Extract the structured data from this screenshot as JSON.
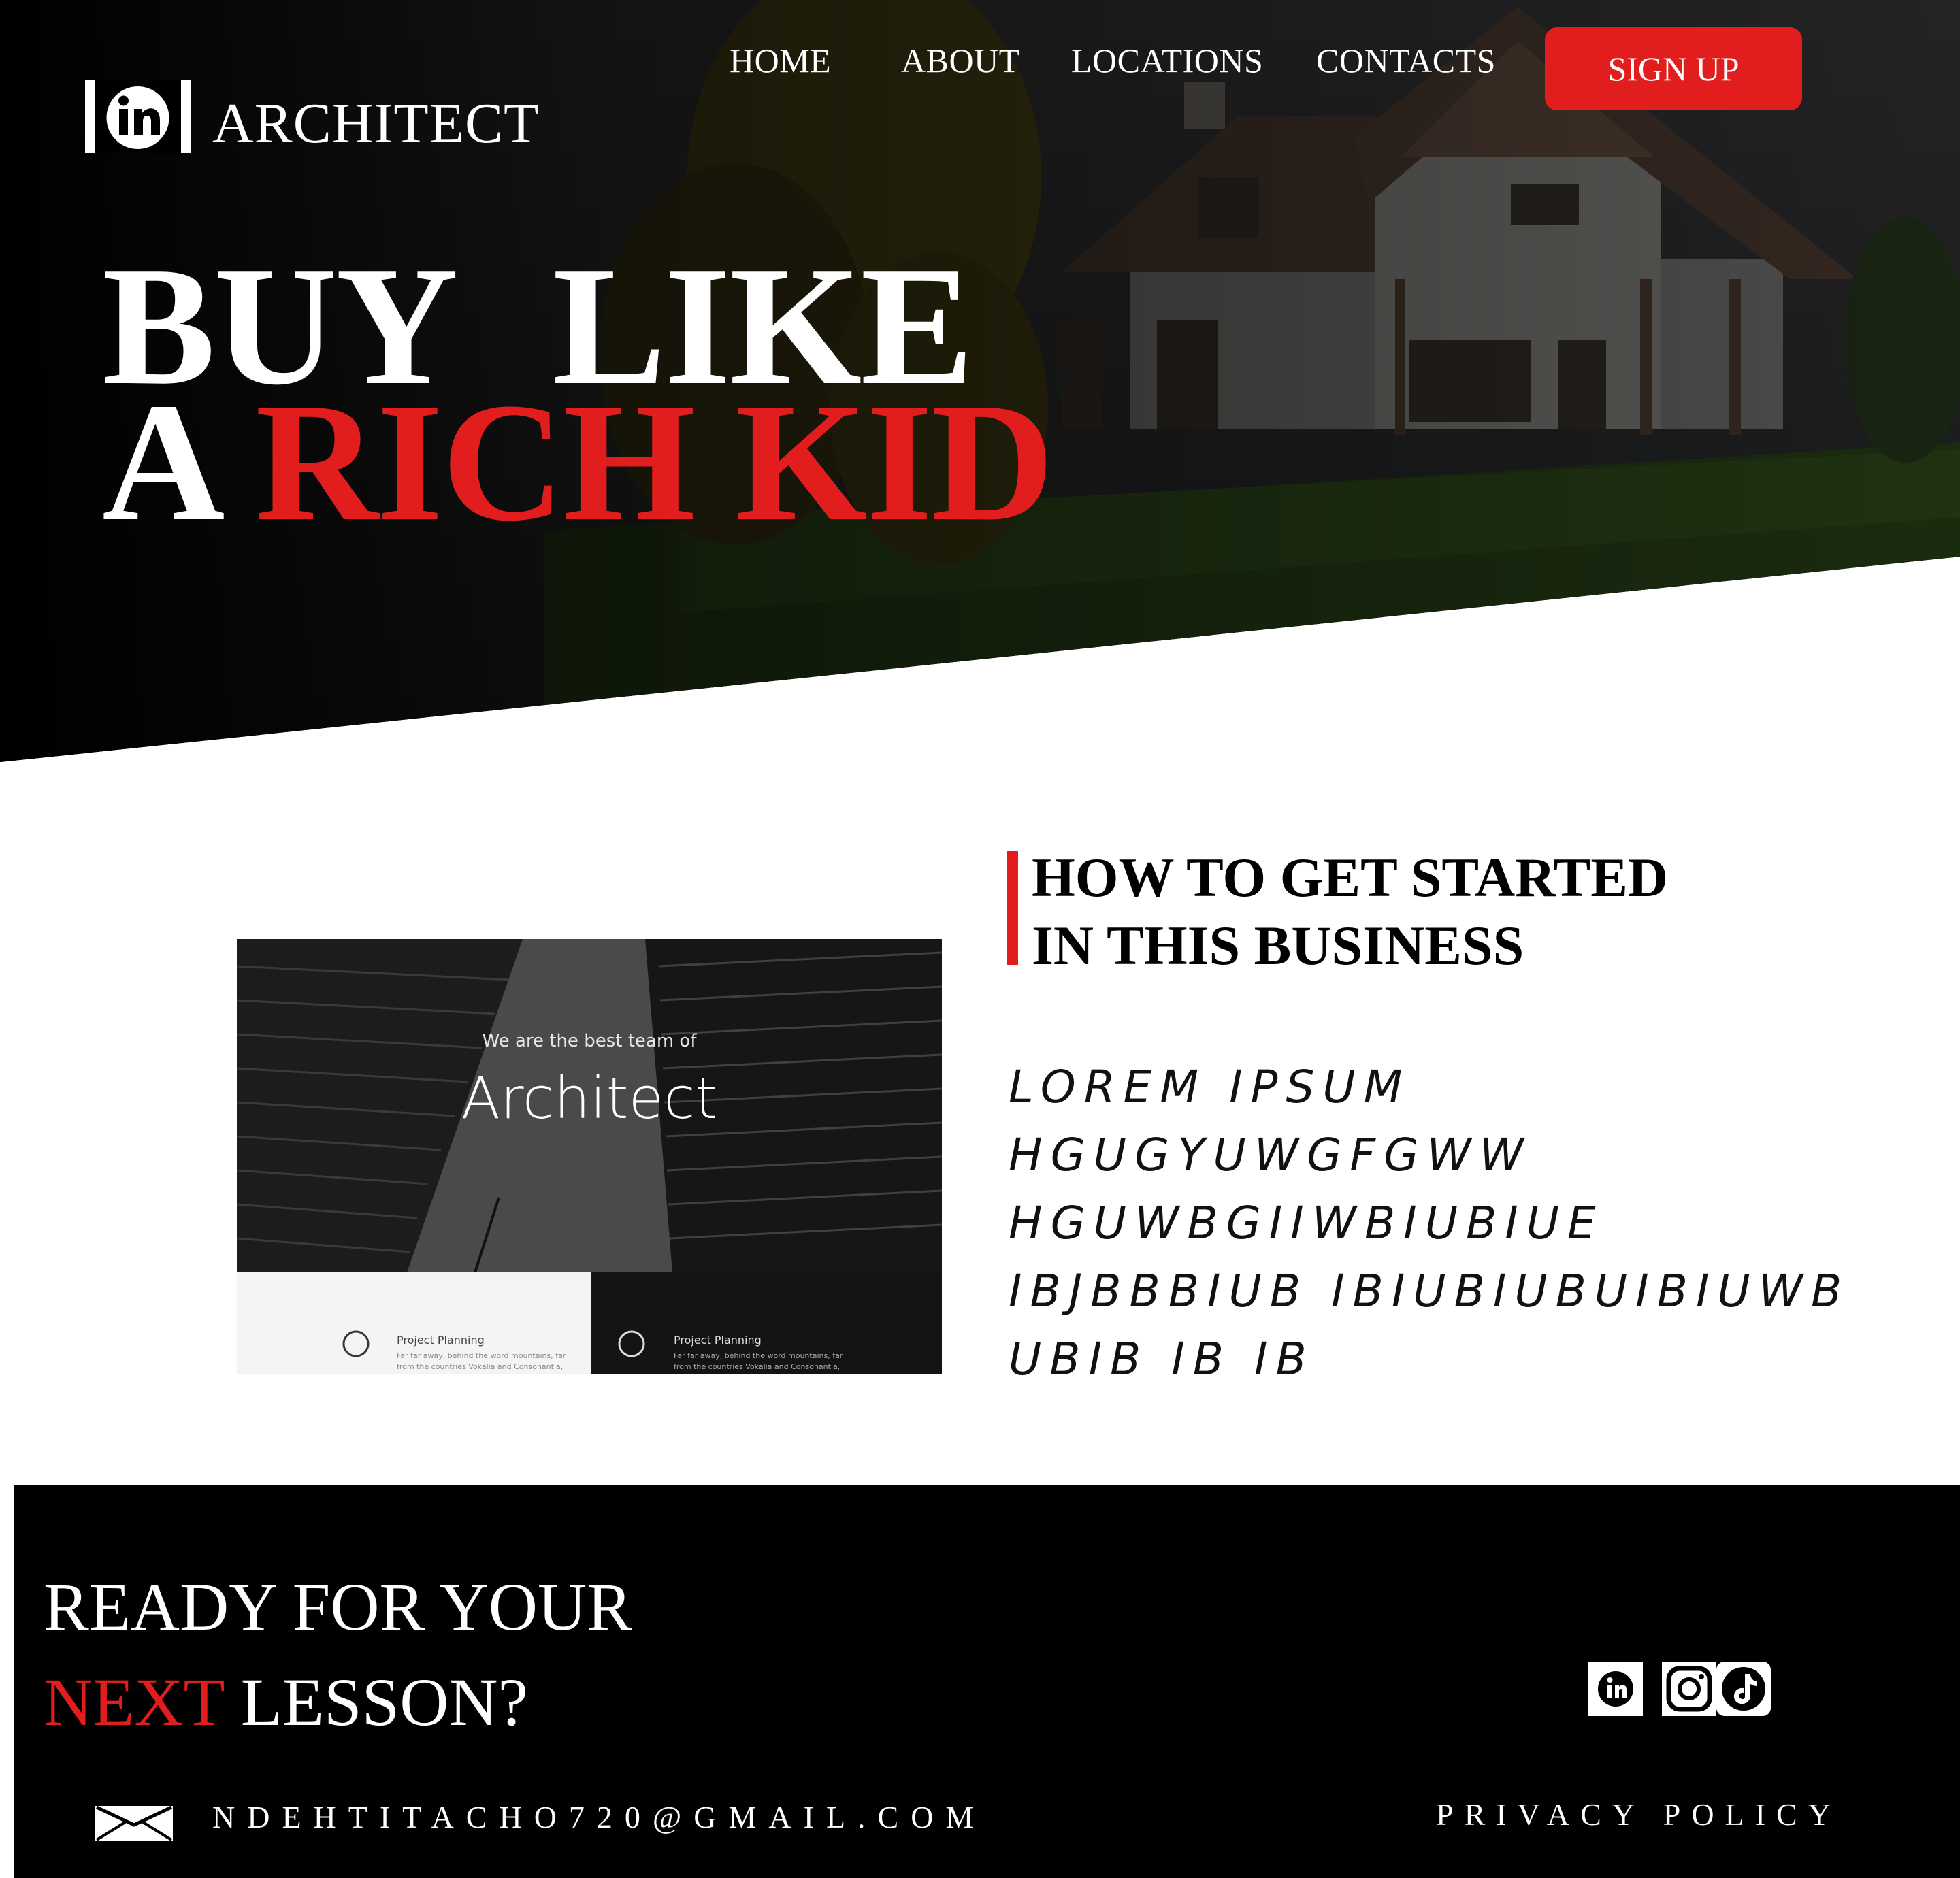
{
  "header": {
    "brand": "ARCHITECT",
    "logo_icon": "in-logo-icon",
    "nav": [
      "HOME",
      "ABOUT",
      "LOCATIONS",
      "CONTACTS"
    ],
    "signup_label": "SIGN UP"
  },
  "hero": {
    "line1_word1": "BUY",
    "line1_word2": "LIKE",
    "line2_plain": "A ",
    "line2_accent": "RICH KID"
  },
  "about": {
    "mockup": {
      "subtitle": "We are the best team of",
      "title": "Architect",
      "cards": [
        {
          "title": "Project Planning",
          "text": "Far far away, behind the word mountains, far from the countries Vokalia and Consonantia, there live"
        },
        {
          "title": "Project Planning",
          "text": "Far far away, behind the word mountains, far from the countries Vokalia and Consonantia, there live"
        }
      ]
    },
    "title_line1": "HOW TO GET STARTED",
    "title_line2": "IN THIS BUSINESS",
    "body_lines": [
      "LOREM IPSUM",
      "HGUGYUWGFGWW",
      "HGUWBGIIWBIUBIUE",
      "IBJBBBIUB IBIUBIUBUIBIUWB",
      "UBIB IB IB"
    ]
  },
  "footer": {
    "cta_line1": "READY FOR YOUR",
    "cta_accent": "NEXT",
    "cta_rest": " LESSON?",
    "email": "NDEHTITACHO720@GMAIL.COM",
    "privacy": "PRIVACY POLICY",
    "social": [
      "linkedin-icon",
      "instagram-icon",
      "tiktok-icon"
    ]
  },
  "colors": {
    "accent": "#e21d1d",
    "dark": "#000000",
    "light": "#ffffff"
  }
}
